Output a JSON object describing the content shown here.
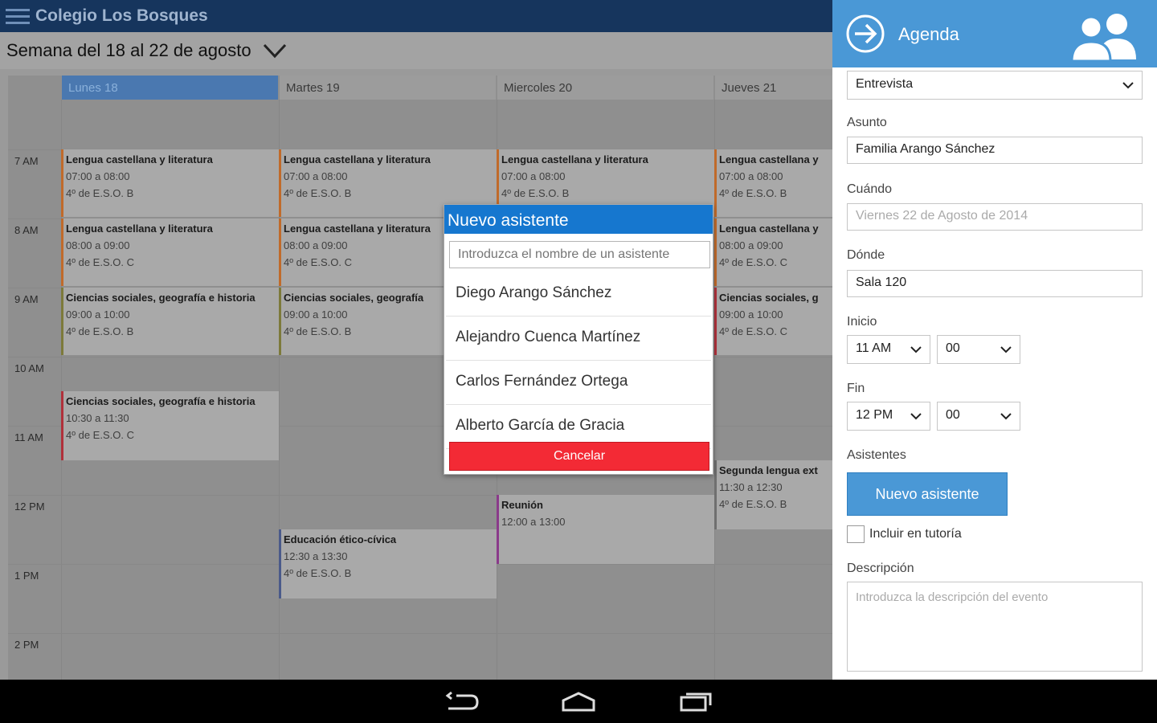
{
  "app": {
    "title": "Colegio Los Bosques"
  },
  "week": {
    "label": "Semana del 18 al 22 de agosto"
  },
  "days": [
    "Lunes 18",
    "Martes 19",
    "Miercoles 20",
    "Jueves 21"
  ],
  "hours": [
    "7 AM",
    "8 AM",
    "9 AM",
    "10 AM",
    "11 AM",
    "12 PM",
    "1 PM",
    "2 PM"
  ],
  "events": {
    "lun_lengua_7": {
      "title": "Lengua castellana y literatura",
      "time": "07:00 a 08:00",
      "group": "4º de E.S.O. B"
    },
    "lun_lengua_8": {
      "title": "Lengua castellana y literatura",
      "time": "08:00 a 09:00",
      "group": "4º de E.S.O. C"
    },
    "lun_cs_9": {
      "title": "Ciencias sociales, geografía e historia",
      "time": "09:00 a 10:00",
      "group": "4º de E.S.O. B"
    },
    "lun_cs_1030": {
      "title": "Ciencias sociales, geografía e historia",
      "time": "10:30 a 11:30",
      "group": "4º de E.S.O. C"
    },
    "mar_lengua_7": {
      "title": "Lengua castellana y literatura",
      "time": "07:00 a 08:00",
      "group": "4º de E.S.O. B"
    },
    "mar_lengua_8": {
      "title": "Lengua castellana y literatura",
      "time": "08:00 a 09:00",
      "group": "4º de E.S.O. C"
    },
    "mar_cs_9": {
      "title": "Ciencias sociales, geografía",
      "time": "09:00 a 10:00",
      "group": "4º de E.S.O. B"
    },
    "mar_etica": {
      "title": "Educación ético-cívica",
      "time": "12:30 a 13:30",
      "group": "4º de E.S.O. B"
    },
    "mie_lengua_7": {
      "title": "Lengua castellana y literatura",
      "time": "07:00 a 08:00",
      "group": "4º de E.S.O. B"
    },
    "mie_reunion": {
      "title": "Reunión",
      "time": "12:00 a 13:00"
    },
    "jue_lengua_7": {
      "title": "Lengua castellana y",
      "time": "07:00 a 08:00",
      "group": "4º de E.S.O. B"
    },
    "jue_lengua_8": {
      "title": "Lengua castellana y",
      "time": "08:00 a 09:00",
      "group": "4º de E.S.O. C"
    },
    "jue_cs_9": {
      "title": "Ciencias sociales, g",
      "time": "09:00 a 10:00",
      "group": "4º de E.S.O. C"
    },
    "jue_segunda": {
      "title": "Segunda lengua ext",
      "time": "11:30 a 12:30",
      "group": "4º de E.S.O. B"
    }
  },
  "modal": {
    "title": "Nuevo asistente",
    "search_placeholder": "Introduzca el nombre de un asistente",
    "attendees": [
      "Diego Arango Sánchez",
      "Alejandro Cuenca Martínez",
      "Carlos Fernández Ortega",
      "Alberto García de Gracia"
    ],
    "cancel_label": "Cancelar"
  },
  "panel": {
    "title": "Agenda",
    "type_value": "Entrevista",
    "asunto_label": "Asunto",
    "asunto_value": "Familia Arango Sánchez",
    "cuando_label": "Cuándo",
    "cuando_value": "Viernes 22 de Agosto de 2014",
    "donde_label": "Dónde",
    "donde_value": "Sala 120",
    "inicio_label": "Inicio",
    "inicio_hour": "11 AM",
    "inicio_min": "00",
    "fin_label": "Fin",
    "fin_hour": "12 PM",
    "fin_min": "00",
    "asistentes_label": "Asistentes",
    "new_attendee_label": "Nuevo asistente",
    "tutoria_label": "Incluir en tutoría",
    "descripcion_label": "Descripción",
    "descripcion_placeholder": "Introduzca la descripción del evento"
  },
  "colors": {
    "accent": "#4a98d6",
    "modal_header": "#1677cf",
    "cancel": "#f32a35",
    "topbar": "#16355d"
  }
}
